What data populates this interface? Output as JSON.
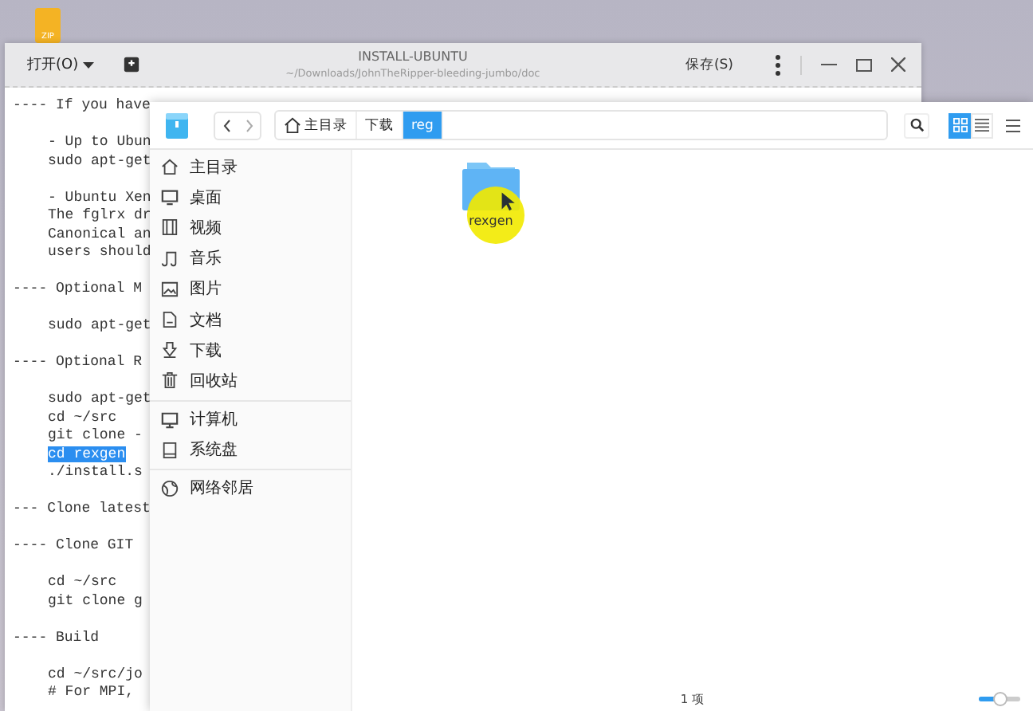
{
  "desktop": {
    "icon_label": "ZIP"
  },
  "editor": {
    "open_menu": "打开(O)",
    "title": "INSTALL-UBUNTU",
    "path": "~/Downloads/JohnTheRipper-bleeding-jumbo/doc",
    "save": "保存(S)",
    "blocks": [
      {
        "kind": "heading",
        "lines": [
          {
            "text": "---- If you have",
            "selected": false
          }
        ]
      },
      {
        "kind": "code",
        "lines": [
          {
            "text": "- Up to Ubun",
            "selected": false
          },
          {
            "text": "sudo apt-get",
            "selected": false
          }
        ]
      },
      {
        "kind": "code",
        "lines": [
          {
            "text": "- Ubuntu Xen",
            "selected": false
          },
          {
            "text": "The fglrx dr",
            "selected": false
          },
          {
            "text": "Canonical an",
            "selected": false
          },
          {
            "text": "users should",
            "selected": false
          }
        ]
      },
      {
        "kind": "heading",
        "lines": [
          {
            "text": "---- Optional M",
            "selected": false
          }
        ]
      },
      {
        "kind": "code",
        "lines": [
          {
            "text": "sudo apt-get",
            "selected": false
          }
        ]
      },
      {
        "kind": "heading",
        "lines": [
          {
            "text": "---- Optional R",
            "selected": false
          }
        ]
      },
      {
        "kind": "code",
        "lines": [
          {
            "text": "sudo apt-get",
            "selected": false
          },
          {
            "text": "cd ~/src",
            "selected": false
          },
          {
            "text": "git clone -",
            "selected": false
          },
          {
            "text": "cd rexgen",
            "selected": true
          },
          {
            "text": "./install.s",
            "selected": false
          }
        ]
      },
      {
        "kind": "heading",
        "lines": [
          {
            "text": "--- Clone latest",
            "selected": false
          }
        ]
      },
      {
        "kind": "heading",
        "lines": [
          {
            "text": "---- Clone GIT",
            "selected": false
          }
        ]
      },
      {
        "kind": "code",
        "lines": [
          {
            "text": "cd ~/src",
            "selected": false
          },
          {
            "text": "git clone g",
            "selected": false
          }
        ]
      },
      {
        "kind": "heading",
        "lines": [
          {
            "text": "---- Build",
            "selected": false
          }
        ]
      },
      {
        "kind": "code",
        "lines": [
          {
            "text": "cd ~/src/jo",
            "selected": false
          },
          {
            "text": "# For MPI,",
            "selected": false
          }
        ]
      }
    ]
  },
  "file_manager": {
    "breadcrumb": [
      {
        "label": "主目录",
        "selected": false
      },
      {
        "label": "下载",
        "selected": false
      },
      {
        "label": "reg",
        "selected": true
      }
    ],
    "view_modes": [
      {
        "selected": true
      },
      {
        "selected": false
      }
    ],
    "sidebar": {
      "groups": [
        {
          "items": [
            {
              "label": "主目录"
            },
            {
              "label": "桌面"
            },
            {
              "label": "视频"
            },
            {
              "label": "音乐"
            },
            {
              "label": "图片"
            },
            {
              "label": "文档"
            },
            {
              "label": "下载"
            },
            {
              "label": "回收站"
            }
          ]
        },
        {
          "items": [
            {
              "label": "计算机"
            },
            {
              "label": "系统盘"
            }
          ]
        },
        {
          "items": [
            {
              "label": "网络邻居"
            }
          ]
        }
      ]
    },
    "files": [
      {
        "name": "rexgen"
      }
    ],
    "status_bar": {
      "count": "1 项",
      "zoom": {
        "level": 0.55
      }
    }
  }
}
